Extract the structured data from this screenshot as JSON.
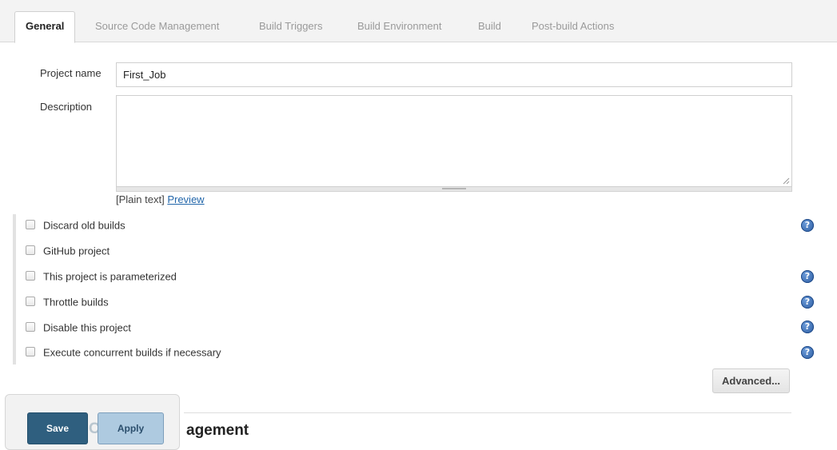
{
  "tabs": [
    {
      "label": "General",
      "active": true
    },
    {
      "label": "Source Code Management",
      "active": false
    },
    {
      "label": "Build Triggers",
      "active": false
    },
    {
      "label": "Build Environment",
      "active": false
    },
    {
      "label": "Build",
      "active": false
    },
    {
      "label": "Post-build Actions",
      "active": false
    }
  ],
  "form": {
    "project_name_label": "Project name",
    "project_name_value": "First_Job",
    "description_label": "Description",
    "description_value": "",
    "markup_hint": "[Plain text]",
    "preview_link": "Preview"
  },
  "options": [
    {
      "label": "Discard old builds",
      "checked": false,
      "help": true
    },
    {
      "label": "GitHub project",
      "checked": false,
      "help": false
    },
    {
      "label": "This project is parameterized",
      "checked": false,
      "help": true
    },
    {
      "label": "Throttle builds",
      "checked": false,
      "help": true
    },
    {
      "label": "Disable this project",
      "checked": false,
      "help": true
    },
    {
      "label": "Execute concurrent builds if necessary",
      "checked": false,
      "help": true
    }
  ],
  "help_icon_glyph": "?",
  "advanced_button": "Advanced...",
  "next_section_title": "agement",
  "next_section_faded": "C",
  "bottom_bar": {
    "save": "Save",
    "apply": "Apply"
  },
  "colors": {
    "save_bg": "#2f5f7f",
    "apply_bg": "#aecae0",
    "help_icon": "#2a5aa0",
    "link": "#2266aa"
  }
}
